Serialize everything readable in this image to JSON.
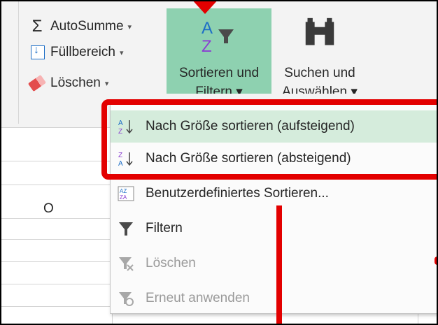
{
  "ribbon": {
    "autosum_label": "AutoSumme",
    "fill_label": "Füllbereich",
    "clear_label": "Löschen",
    "sort_filter_line1": "Sortieren und",
    "sort_filter_line2": "Filtern",
    "find_select_line1": "Suchen und",
    "find_select_line2": "Auswählen"
  },
  "sheet": {
    "column_letter": "O"
  },
  "menu": {
    "items": [
      {
        "label": "Nach Größe sortieren (aufsteigend)",
        "icon": "sort-ascending-icon",
        "enabled": true,
        "highlighted": true
      },
      {
        "label": "Nach Größe sortieren (absteigend)",
        "icon": "sort-descending-icon",
        "enabled": true,
        "highlighted": false
      },
      {
        "label": "Benutzerdefiniertes Sortieren...",
        "icon": "custom-sort-icon",
        "enabled": true,
        "highlighted": false
      },
      {
        "label": "Filtern",
        "icon": "filter-icon",
        "enabled": true,
        "highlighted": false
      },
      {
        "label": "Löschen",
        "icon": "clear-filter-icon",
        "enabled": false,
        "highlighted": false
      },
      {
        "label": "Erneut anwenden",
        "icon": "reapply-icon",
        "enabled": false,
        "highlighted": false
      }
    ]
  },
  "colors": {
    "accent_green": "#8ed1b0",
    "highlight": "#d5ecdc",
    "annotation_red": "#e30000"
  }
}
